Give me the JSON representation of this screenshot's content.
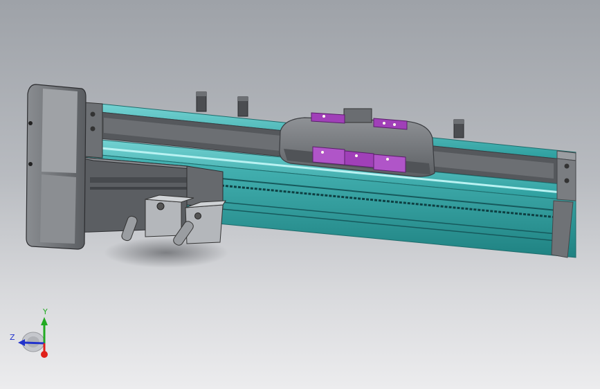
{
  "viewport": {
    "background_top": "#9ea2a8",
    "background_bottom": "#ececee"
  },
  "model": {
    "description_colors": {
      "rail": "#2fa6a6",
      "rail_light": "#66cfcf",
      "body_dark": "#5e6064",
      "body_mid": "#7d8084",
      "body_light": "#a9acb0",
      "carriage_plate": "#a040b8",
      "carriage_plate_light": "#c46fd8"
    }
  },
  "triad": {
    "x_label": "",
    "y_label": "Y",
    "z_label": "Z",
    "x_color": "#e0201a",
    "y_color": "#22aa22",
    "z_color": "#2233cc"
  }
}
